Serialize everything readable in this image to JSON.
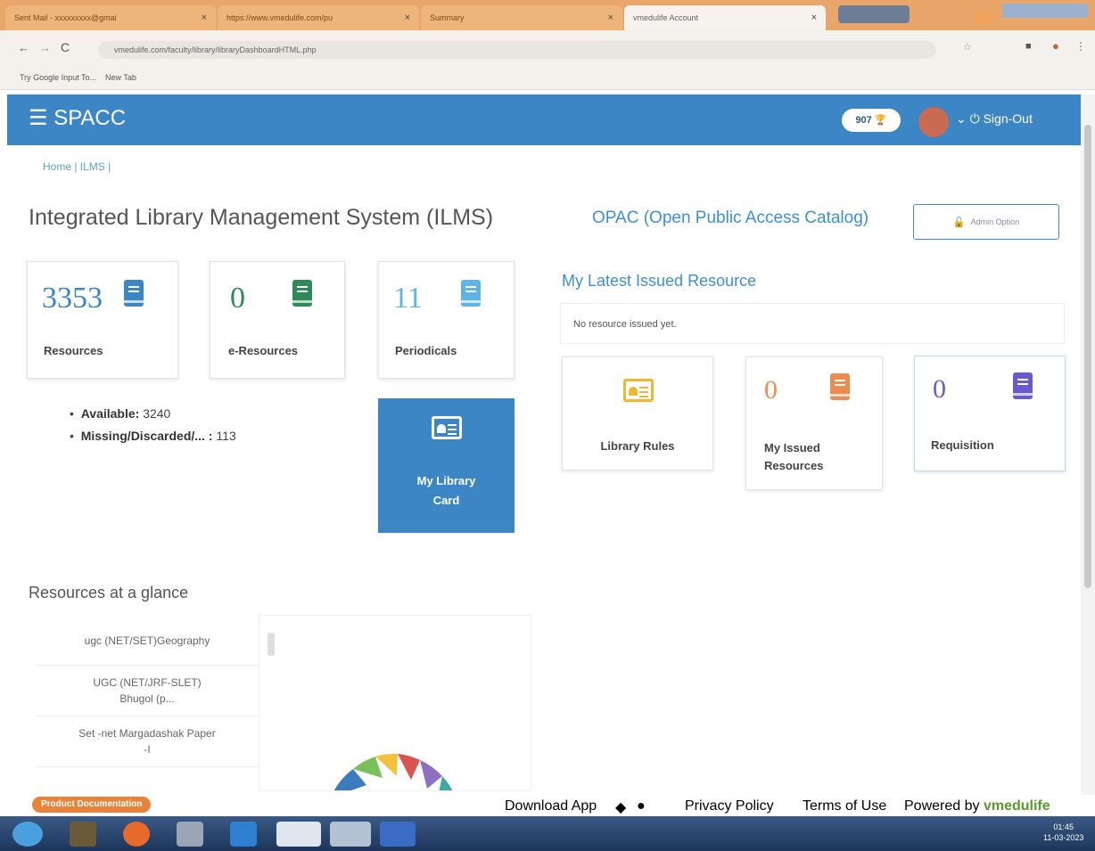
{
  "browser": {
    "tabs": [
      {
        "label": "Sent Mail - xxxxxxxxx@gmai"
      },
      {
        "label": "https://www.vmedulife.com/pu"
      },
      {
        "label": "Summary"
      },
      {
        "label": "vmedulife Account"
      }
    ],
    "url": "vmedulife.com/faculty/library/libraryDashboardHTML.php",
    "bookmarks": [
      "Try Google Input To...",
      "New Tab"
    ]
  },
  "header": {
    "brand": "SPACC",
    "points": "907",
    "signout": "Sign-Out"
  },
  "breadcrumb": "Home | ILMS |",
  "page_title": "Integrated Library Management System (ILMS)",
  "opac_link": "OPAC (Open Public Access Catalog)",
  "admin_button": "Admin Option",
  "stat_cards": [
    {
      "value": "3353",
      "label": "Resources",
      "color": "#3d86c6"
    },
    {
      "value": "0",
      "label": "e-Resources",
      "color": "#2e8b57"
    },
    {
      "value": "11",
      "label": "Periodicals",
      "color": "#5fb4e6"
    }
  ],
  "availability": {
    "available_label": "Available:",
    "available_value": "3240",
    "missing_label": "Missing/Discarded/... :",
    "missing_value": "113"
  },
  "my_library_card": {
    "line1": "My Library",
    "line2": "Card"
  },
  "latest": {
    "title": "My Latest Issued Resource",
    "empty_text": "No resource issued yet."
  },
  "action_cards": [
    {
      "label": "Library Rules",
      "icon": "id-card-icon",
      "color": "#f0b733"
    },
    {
      "label_line1": "My Issued",
      "label_line2": "Resources",
      "value": "0",
      "icon": "book-icon",
      "color": "#ec8d4f"
    },
    {
      "label": "Requisition",
      "value": "0",
      "icon": "book-icon",
      "color": "#6a5acd"
    }
  ],
  "glance": {
    "title": "Resources at a glance",
    "items": [
      {
        "line1": "ugc (NET/SET)Geography",
        "line2": ""
      },
      {
        "line1": "UGC (NET/JRF-SLET)",
        "line2": "Bhugol (p..."
      },
      {
        "line1": "Set -net Margadashak Paper",
        "line2": "-I"
      }
    ]
  },
  "footer": {
    "product_doc": "Product Documentation",
    "download_app": "Download App",
    "privacy": "Privacy Policy",
    "terms": "Terms of Use",
    "powered_by": "Powered by",
    "brand": "vmedulife"
  },
  "taskbar": {
    "time": "01:45",
    "date": "11-03-2023"
  }
}
